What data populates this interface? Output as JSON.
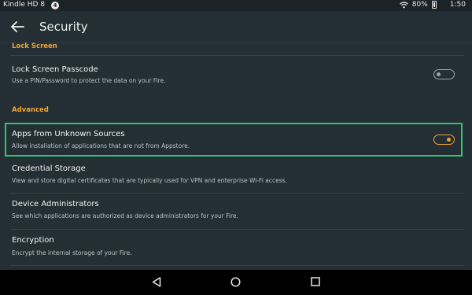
{
  "status_bar": {
    "device_name": "Kindle HD 8",
    "notification_count": "4",
    "battery_percent": "80%",
    "time": "1:50",
    "icons": [
      "wifi-icon",
      "battery-icon"
    ]
  },
  "app_bar": {
    "back_icon": "arrow-left-icon",
    "title": "Security"
  },
  "sections": {
    "lock_screen": {
      "header": "Lock Screen"
    },
    "advanced": {
      "header": "Advanced"
    }
  },
  "settings": {
    "lock_passcode": {
      "title": "Lock Screen Passcode",
      "description": "Use a PIN/Password to protect the data on your Fire.",
      "enabled": false
    },
    "unknown_sources": {
      "title": "Apps from Unknown Sources",
      "description": "Allow installation of applications that are not from Appstore.",
      "enabled": true
    },
    "credential_storage": {
      "title": "Credential Storage",
      "description": "View and store digital certificates that are typically used for VPN and enterprise Wi-Fi access."
    },
    "device_admins": {
      "title": "Device Administrators",
      "description": "See which applications are authorized as device administrators for your Fire."
    },
    "encryption": {
      "title": "Encryption",
      "description": "Encrypt the internal storage of your Fire."
    }
  },
  "nav_bar": {
    "icons": [
      "back-triangle-icon",
      "home-circle-icon",
      "recents-square-icon"
    ]
  },
  "colors": {
    "accent": "#f0a330",
    "highlight": "#36c26c",
    "background": "#232f35"
  }
}
